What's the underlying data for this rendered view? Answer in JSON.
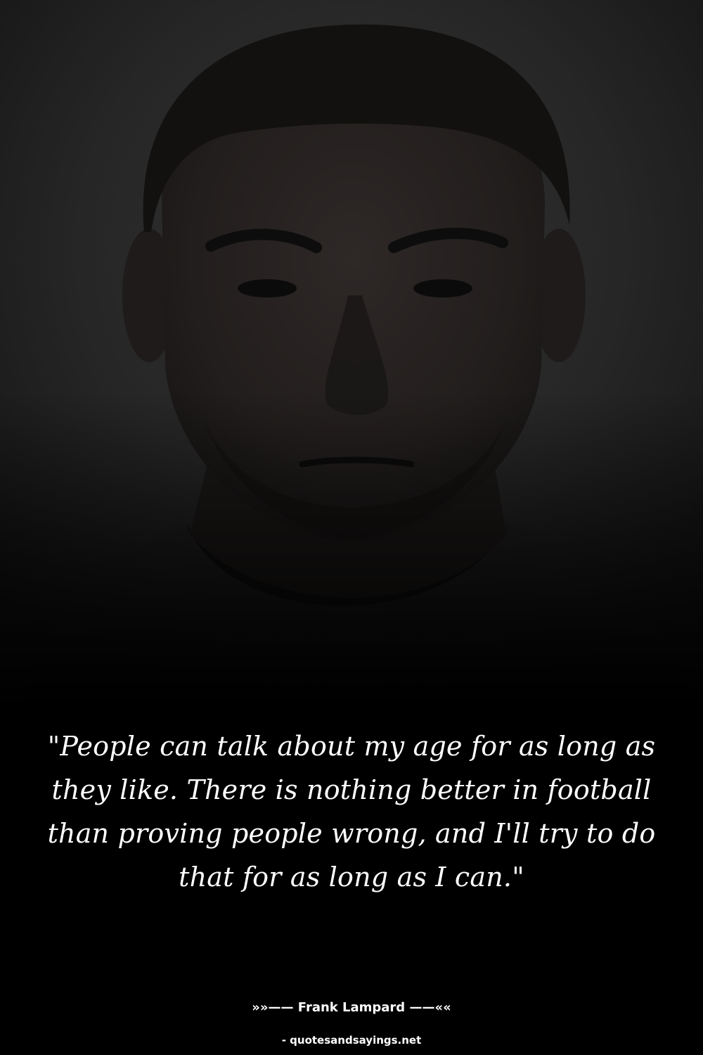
{
  "quote": {
    "text": "\"People can talk about my age for as long as they like. There is nothing better in football than proving people wrong, and I'll try to do that for as long as I can.\""
  },
  "author": {
    "line": "»»—— Frank Lampard ——««"
  },
  "source": {
    "text": "- quotesandsayings.net"
  },
  "colors": {
    "background": "#000000",
    "text": "#ffffff"
  }
}
